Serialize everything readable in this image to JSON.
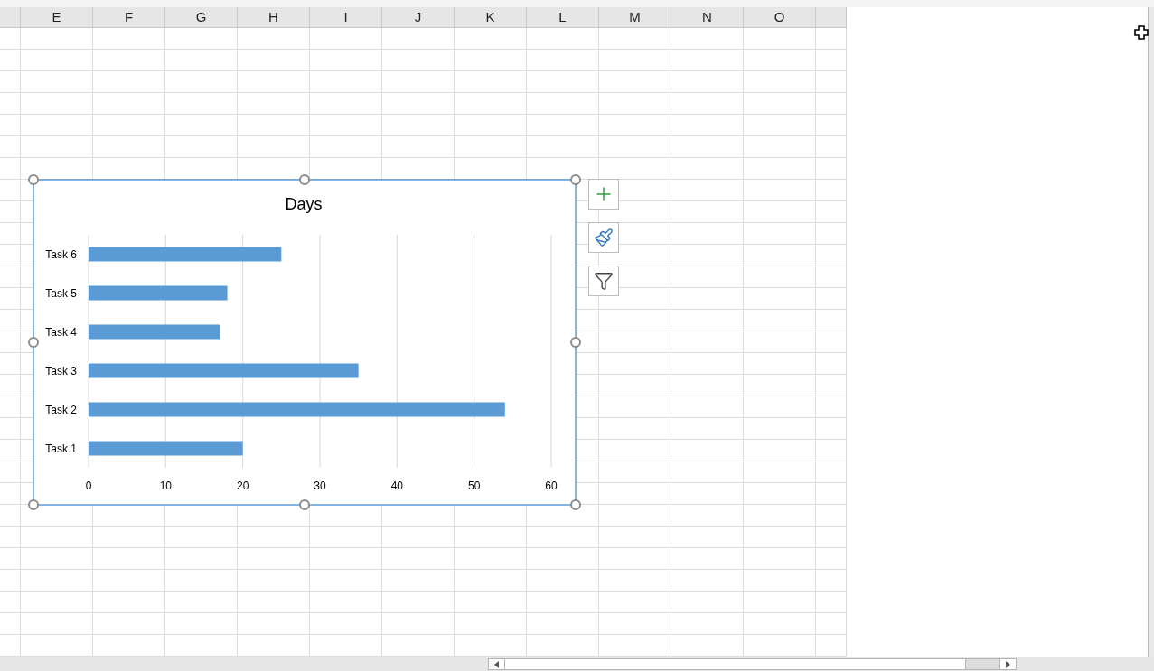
{
  "columns": [
    "",
    "E",
    "F",
    "G",
    "H",
    "I",
    "J",
    "K",
    "L",
    "M",
    "N",
    "O",
    ""
  ],
  "chart_tools": [
    {
      "kind": "elements"
    },
    {
      "kind": "styles"
    },
    {
      "kind": "filters"
    }
  ],
  "chart": {
    "chart_data": {
      "type": "bar",
      "orientation": "horizontal",
      "title": "Days",
      "grid": true,
      "categories": [
        "Task 6",
        "Task 5",
        "Task 4",
        "Task 3",
        "Task 2",
        "Task 1"
      ],
      "series": [
        {
          "color": "#5b9bd5",
          "values": [
            25,
            18,
            17,
            35,
            54,
            20
          ]
        }
      ],
      "xlim": [
        0,
        60
      ],
      "xticks": [
        0,
        10,
        20,
        30,
        40,
        50,
        60
      ]
    }
  }
}
